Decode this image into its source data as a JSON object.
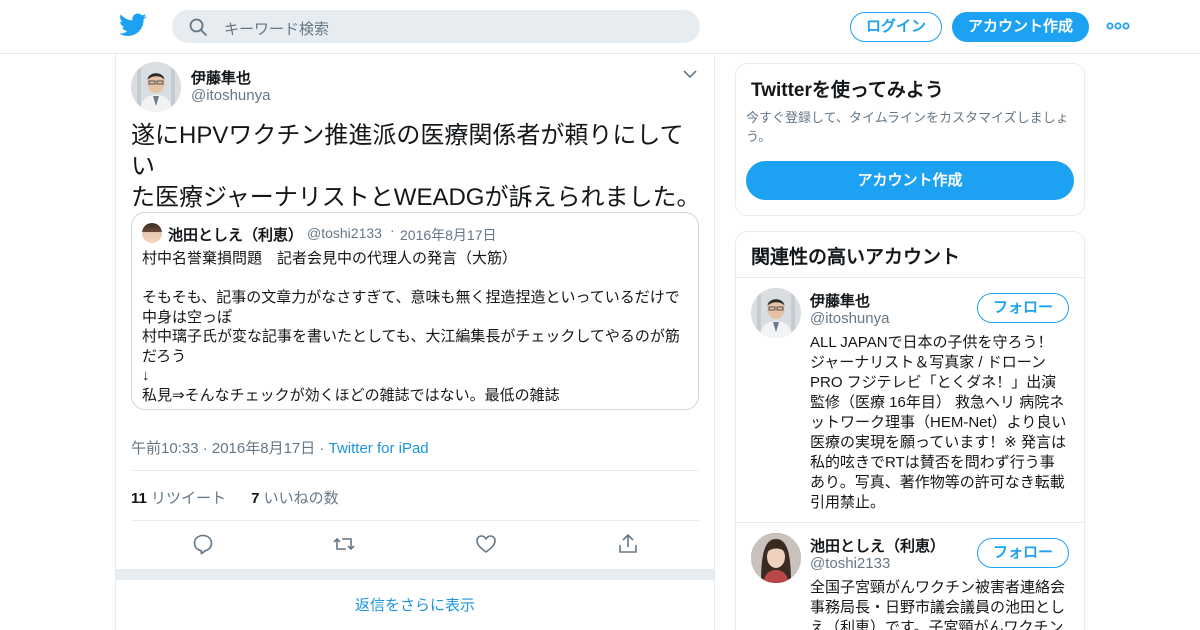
{
  "colors": {
    "accent": "#1da1f2",
    "link": "#1b95e0",
    "muted": "#657786",
    "text": "#14171a",
    "border": "#e6ecf0"
  },
  "nav": {
    "logo_icon": "twitter-bird-icon",
    "search_placeholder": "キーワード検索",
    "login_label": "ログイン",
    "signup_label": "アカウント作成",
    "more_icon": "more-dots-icon"
  },
  "tweet": {
    "author_name": "伊藤隼也",
    "author_handle": "@itoshunya",
    "text_lines": [
      "遂にHPVワクチン推進派の医療関係者が頼りにしてい",
      "た医療ジャーナリストとWEADGが訴えられました。"
    ],
    "quote": {
      "author_name": "池田としえ（利恵）",
      "author_handle": "@toshi2133",
      "separator": "·",
      "date": "2016年8月17日",
      "lines": [
        "村中名誉棄損問題　記者会見中の代理人の発言（大筋）",
        "",
        "そもそも、記事の文章力がなさすぎて、意味も無く捏造捏造といっているだけで",
        "中身は空っぽ",
        "村中璃子氏が変な記事を書いたとしても、大江編集長がチェックしてやるのが筋",
        "だろう",
        "↓",
        "私見⇒そんなチェックが効くほどの雑誌ではない。最低の雑誌"
      ]
    },
    "timestamp": "午前10:33 · 2016年8月17日",
    "meta_separator": "·",
    "source": "Twitter for iPad",
    "retweet_count": "11",
    "retweet_label": "リツイート",
    "like_count": "7",
    "like_label": "いいねの数",
    "actions": [
      "reply-icon",
      "retweet-icon",
      "like-icon",
      "share-icon"
    ],
    "more_replies": "返信をさらに表示"
  },
  "sidebar": {
    "signup_card": {
      "title": "Twitterを使ってみよう",
      "subtitle": "今すぐ登録して、タイムラインをカスタマイズしましょう。",
      "cta": "アカウント作成"
    },
    "related": {
      "title": "関連性の高いアカウント",
      "accounts": [
        {
          "name": "伊藤隼也",
          "handle": "@itoshunya",
          "follow_label": "フォロー",
          "bio_lines": [
            "ALL JAPANで日本の子供を守ろう！",
            "ジャーナリスト＆写真家 / ドローン",
            "PRO フジテレビ「とくダネ！」出演",
            "監修（医療 16年目） 救急ヘリ 病院ネ",
            "ットワーク理事（HEM-Net）より良い",
            "医療の実現を願っています！※ 発言は",
            "私的呟きでRTは賛否を問わず行う事",
            "あり。写真、著作物等の許可なき転載",
            "引用禁止。"
          ]
        },
        {
          "name": "池田としえ（利恵）",
          "handle": "@toshi2133",
          "follow_label": "フォロー",
          "bio_lines": [
            "全国子宮頸がんワクチン被害者連絡会",
            "事務局長・日野市議会議員の池田とし",
            "え（利恵）です。子宮頸がんワクチン"
          ]
        }
      ]
    }
  }
}
